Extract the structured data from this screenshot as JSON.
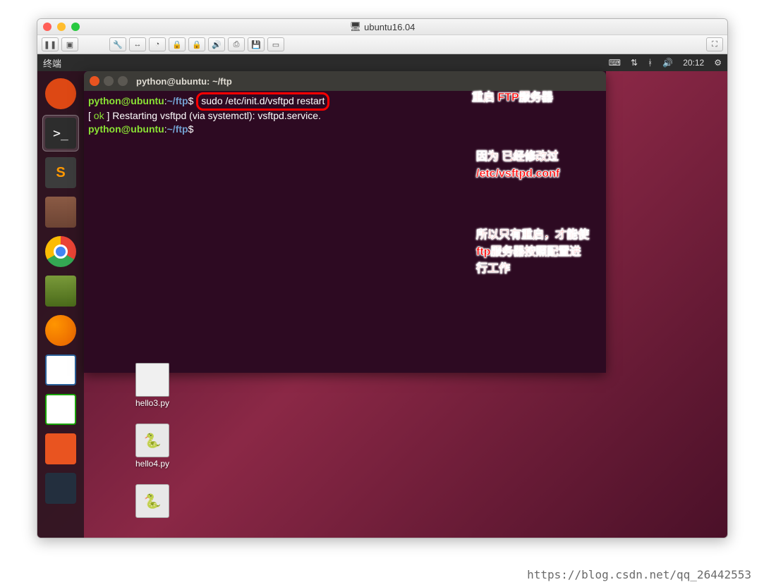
{
  "mac": {
    "title": "ubuntu16.04"
  },
  "panel": {
    "app": "终端",
    "time": "20:12"
  },
  "terminal": {
    "title": "python@ubuntu: ~/ftp",
    "user": "python@ubuntu",
    "path": "~/ftp",
    "cmd1": "sudo /etc/init.d/vsftpd restart",
    "out1_prefix": "[ ",
    "out1_ok": "ok",
    "out1_rest": " ] Restarting vsftpd (via systemctl): vsftpd.service."
  },
  "annotations": {
    "a1": "重启 FTP服务器",
    "a2": "因为 已经修改过 /etc/vsftpd.conf",
    "a3": "所以只有重启，才能使ftp服务器按照配置进行工作"
  },
  "desktop": {
    "file1": "hello3.py",
    "file2": "hello4.py"
  },
  "watermark": "https://blog.csdn.net/qq_26442553"
}
